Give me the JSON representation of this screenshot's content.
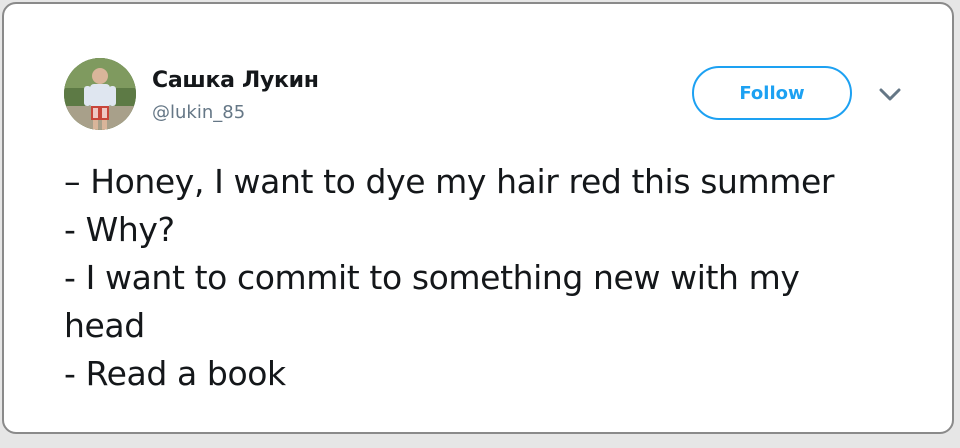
{
  "tweet": {
    "author": {
      "display_name": "Сашка Лукин",
      "handle": "@lukin_85",
      "avatar_icon": "user-photo-avatar"
    },
    "follow_label": "Follow",
    "menu_icon": "chevron-down-icon",
    "lines": [
      "– Honey, I want to dye my hair red this summer",
      "- Why?",
      "- I want to commit to something new with my",
      "head",
      "- Read a book"
    ]
  },
  "colors": {
    "accent": "#1da1f2",
    "text": "#14171a",
    "secondary_text": "#657786",
    "card_border": "#8a8a8a"
  }
}
